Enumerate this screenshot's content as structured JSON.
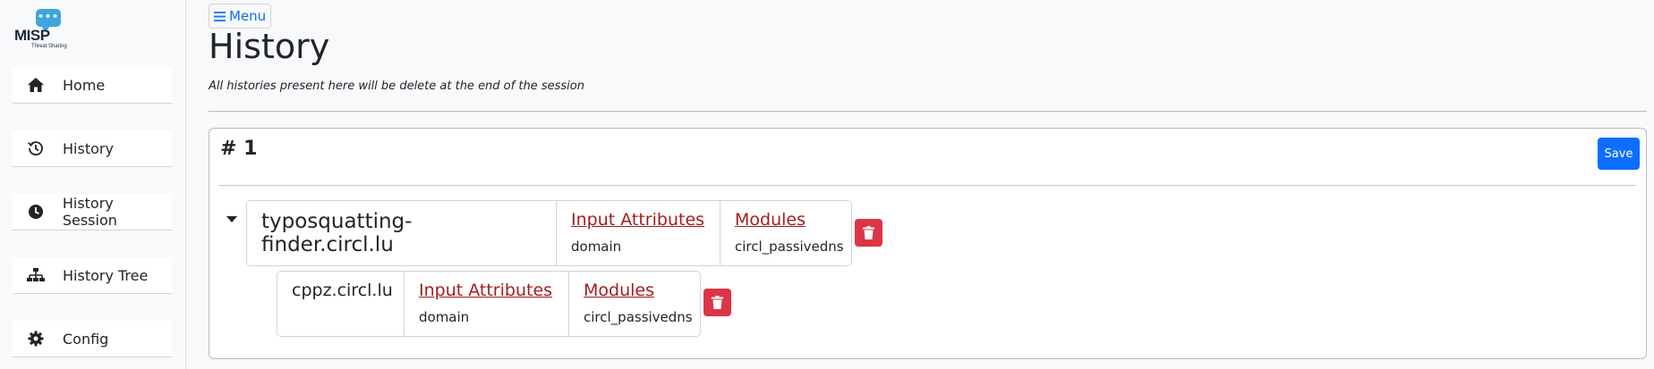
{
  "logo": {
    "text": "MISP",
    "subtext": "Threat Sharing",
    "dots": "•••"
  },
  "sidebar": {
    "items": [
      {
        "label": "Home",
        "icon": "home-icon"
      },
      {
        "label": "History",
        "icon": "history-icon"
      },
      {
        "label": "History Session",
        "icon": "clock-icon"
      },
      {
        "label": "History Tree",
        "icon": "tree-icon"
      },
      {
        "label": "Config",
        "icon": "gear-icon"
      }
    ]
  },
  "header": {
    "menu_label": "Menu",
    "title": "History",
    "subtitle": "All histories present here will be delete at the end of the session"
  },
  "card": {
    "title": "# 1",
    "save_label": "Save",
    "queries": [
      {
        "name": "typosquatting-finder.circl.lu",
        "attributes_label": "Input Attributes",
        "attributes_value": "domain",
        "modules_label": "Modules",
        "modules_value": "circl_passivedns"
      },
      {
        "name": "cppz.circl.lu",
        "attributes_label": "Input Attributes",
        "attributes_value": "domain",
        "modules_label": "Modules",
        "modules_value": "circl_passivedns"
      }
    ]
  },
  "colors": {
    "primary": "#0d6efd",
    "danger": "#dc3545",
    "link": "#a31d1d"
  }
}
